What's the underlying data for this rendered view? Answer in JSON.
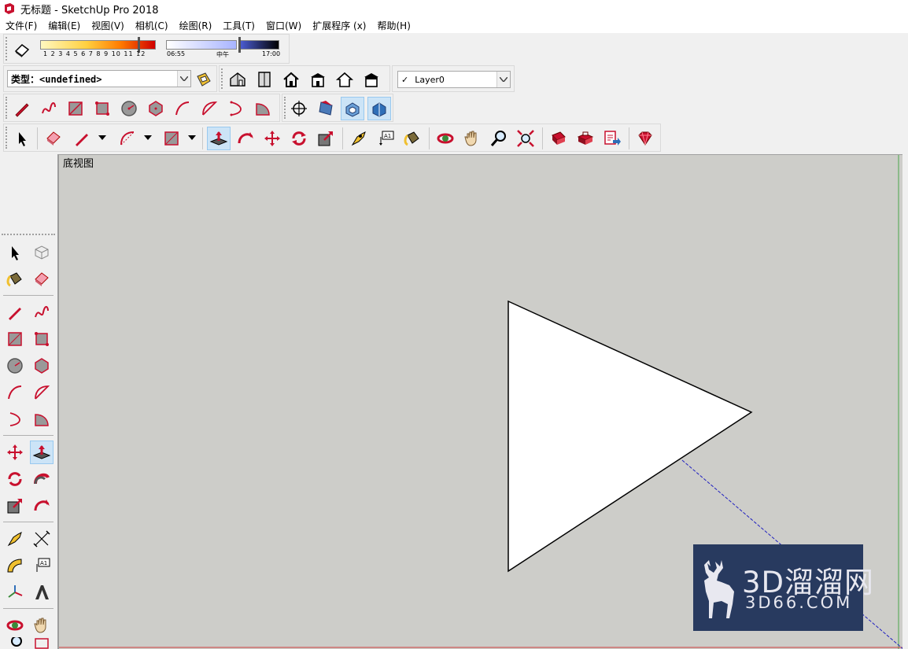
{
  "window": {
    "title": "无标题 - SketchUp Pro 2018"
  },
  "menu": {
    "items": [
      "文件(F)",
      "编辑(E)",
      "视图(V)",
      "相机(C)",
      "绘图(R)",
      "工具(T)",
      "窗口(W)",
      "扩展程序 (x)",
      "帮助(H)"
    ]
  },
  "shadows": {
    "month_ticks": "1 2 3 4 5 6 7 8 9 10 11 12",
    "time_start": "06:55",
    "time_mid": "中午",
    "time_end": "17:00"
  },
  "entity_info": {
    "type_label": "类型：",
    "type_value": "<undefined>"
  },
  "layers": {
    "current": "Layer0",
    "check": "✓"
  },
  "viewport": {
    "view_name": "底视图"
  },
  "watermark": {
    "brand": "3D溜溜网",
    "url": "3D66.COM"
  },
  "colors": {
    "viewport_bg": "#cdcdc9",
    "accent_red": "#c8102e",
    "selected_tool": "#cce4f7",
    "watermark_bg": "#283a5f"
  },
  "icons": {
    "top_row1": [
      "eraser-icon"
    ],
    "styles_row": [
      "iso-house-icon",
      "door-icon",
      "top-house-icon",
      "front-house-icon",
      "outline-house-icon",
      "back-house-icon"
    ],
    "draw_row": [
      "pencil-icon",
      "freehand-icon",
      "rectangle-icon",
      "rotated-rectangle-icon",
      "circle-icon",
      "polygon-icon",
      "arc-icon",
      "two-point-arc-icon",
      "three-point-arc-icon",
      "pie-icon",
      "position-camera-icon",
      "section-plane-icon",
      "display-section-planes-icon",
      "display-section-cuts-icon"
    ],
    "main_row": [
      "select-icon",
      "eraser-icon",
      "pencil-icon",
      "arc-icon",
      "rectangle-icon",
      "push-pull-icon",
      "follow-me-icon",
      "move-icon",
      "rotate-icon",
      "scale-icon",
      "tape-measure-icon",
      "text-icon",
      "paint-bucket-icon",
      "orbit-icon",
      "pan-icon",
      "zoom-icon",
      "zoom-extents-icon",
      "3d-warehouse-icon",
      "extension-warehouse-icon",
      "send-to-layout-icon",
      "ruby-console-icon"
    ]
  }
}
